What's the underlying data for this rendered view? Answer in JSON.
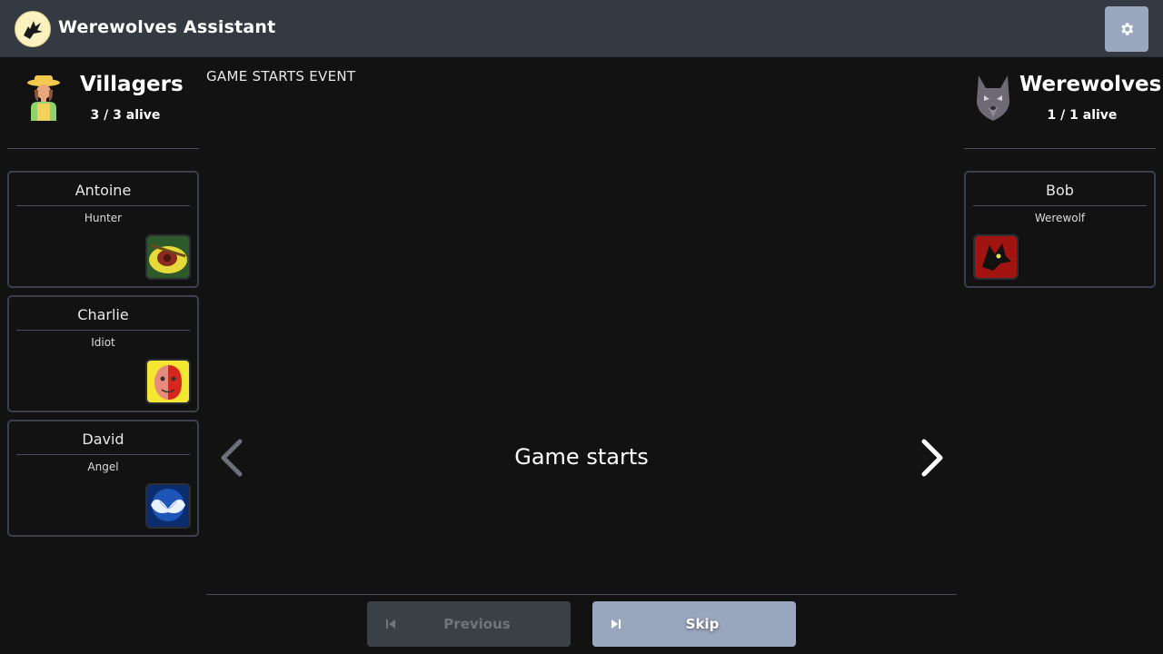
{
  "app": {
    "title": "Werewolves Assistant",
    "logo_icon": "werewolf-logo-icon",
    "settings_icon": "gear-icon"
  },
  "villagers": {
    "name": "Villagers",
    "alive": "3 / 3 alive",
    "icon": "villager-avatar-icon",
    "players": [
      {
        "name": "Antoine",
        "role": "Hunter",
        "role_icon": "hunter-role-icon"
      },
      {
        "name": "Charlie",
        "role": "Idiot",
        "role_icon": "idiot-role-icon"
      },
      {
        "name": "David",
        "role": "Angel",
        "role_icon": "angel-role-icon"
      }
    ]
  },
  "werewolves": {
    "name": "Werewolves",
    "alive": "1 / 1 alive",
    "icon": "wolf-avatar-icon",
    "players": [
      {
        "name": "Bob",
        "role": "Werewolf",
        "role_icon": "werewolf-role-icon"
      }
    ]
  },
  "event": {
    "title": "GAME STARTS EVENT",
    "text": "Game starts"
  },
  "controls": {
    "previous_label": "Previous",
    "skip_label": "Skip",
    "previous_enabled": false
  },
  "colors": {
    "topbar": "#343a42",
    "background": "#121212",
    "skip_button": "#99a6bd",
    "previous_button_disabled": "#3b4047",
    "card_border": "#3b414a"
  }
}
